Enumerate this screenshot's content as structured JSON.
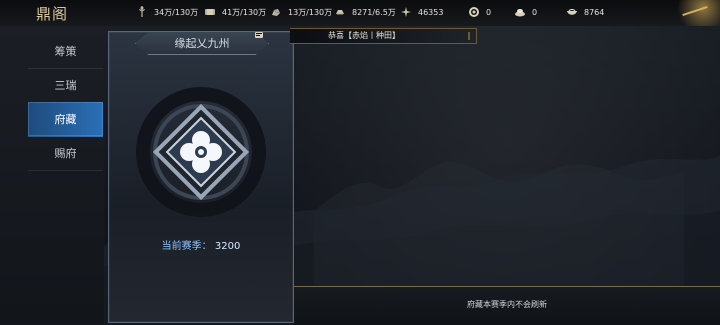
{
  "brand": {
    "logo_text": "鼎阁"
  },
  "resources": [
    {
      "icon": "wheat-icon",
      "text": "34万/130万"
    },
    {
      "icon": "scroll-icon",
      "text": "41万/130万"
    },
    {
      "icon": "ore-icon",
      "text": "13万/130万"
    },
    {
      "icon": "ingot-icon",
      "text": "8271/6.5万"
    },
    {
      "icon": "token-icon",
      "text": "46353"
    },
    {
      "icon": "coin-icon",
      "text": "0"
    },
    {
      "icon": "silver-icon",
      "text": "0"
    },
    {
      "icon": "bowl-icon",
      "text": "8764"
    }
  ],
  "left_nav": {
    "items": [
      {
        "label": "筹策",
        "active": false
      },
      {
        "label": "三瑞",
        "active": false
      },
      {
        "label": "府藏",
        "active": true
      },
      {
        "label": "赐府",
        "active": false
      }
    ]
  },
  "card": {
    "title": "缘起乂九州",
    "season_label": "当前赛季：",
    "season_value": "3200"
  },
  "notice": {
    "text": "恭喜【赤焰丨种田】"
  },
  "footer": {
    "text": "府藏本赛季内不会刷新"
  },
  "colors": {
    "gold": "#d6af5c",
    "active_blue": "#2a6fb7"
  }
}
